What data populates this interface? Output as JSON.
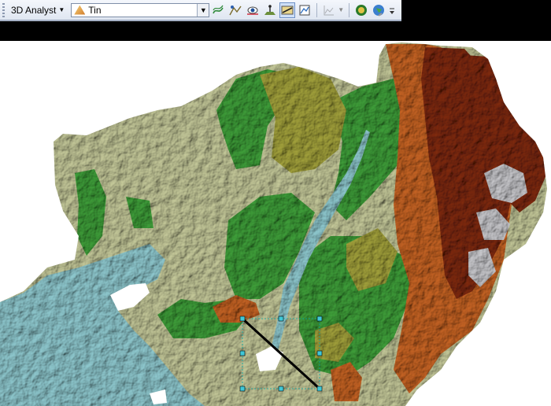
{
  "toolbar": {
    "analyst_label": "3D Analyst",
    "layer_value": "Tin",
    "icons": [
      "contour-icon",
      "steepest-path-icon",
      "line-of-sight-icon",
      "interpolate-point-icon",
      "interpolate-line-icon",
      "interpolate-polygon-icon",
      "profile-graph-icon",
      "arcscene-icon",
      "arcglobe-icon",
      "toolbar-options-icon"
    ]
  },
  "map": {
    "layer": "Tin",
    "colors": {
      "water": "#8fc9cf",
      "lowland": "#c5c99a",
      "green": "#3f9f3a",
      "olive": "#a3a23c",
      "orange": "#c76424",
      "brown": "#7f2a10",
      "snow": "#c8c8cc"
    }
  }
}
